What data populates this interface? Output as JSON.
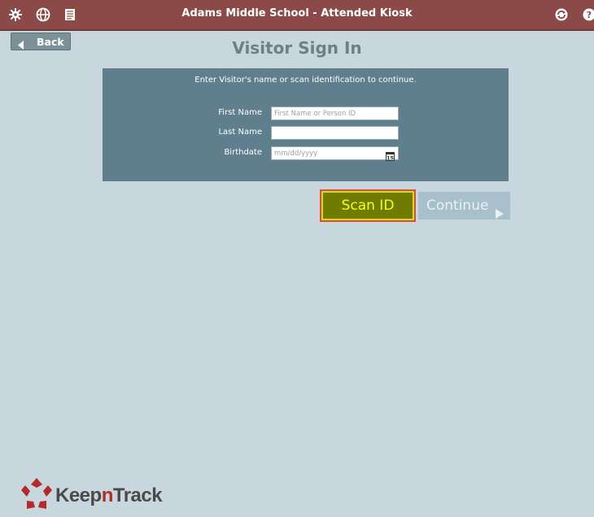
{
  "header": {
    "title": "Adams Middle School - Attended Kiosk",
    "icons": [
      "settings-icon",
      "globe-icon",
      "notes-icon",
      "sync-icon",
      "help-icon"
    ]
  },
  "nav": {
    "back_label": "Back"
  },
  "page": {
    "title": "Visitor Sign In"
  },
  "form": {
    "instruction": "Enter Visitor's name or scan identification to continue.",
    "first_name": {
      "label": "First Name",
      "placeholder": "First Name or Person ID",
      "value": ""
    },
    "last_name": {
      "label": "Last Name",
      "placeholder": "",
      "value": ""
    },
    "birthdate": {
      "label": "Birthdate",
      "placeholder": "mm/dd/yyyy",
      "value": ""
    }
  },
  "actions": {
    "scan_label": "Scan ID",
    "continue_label": "Continue"
  },
  "brand": {
    "logo_text": "KeepnTrack"
  },
  "colors": {
    "header_bg": "#8b4a47",
    "page_bg": "#c8d7dd",
    "panel_bg": "#607f8e",
    "scan_bg": "#6f7c00",
    "scan_text": "#f2ff1a",
    "scan_outline": "#e04a4a",
    "continue_bg": "#a8c0cc"
  }
}
